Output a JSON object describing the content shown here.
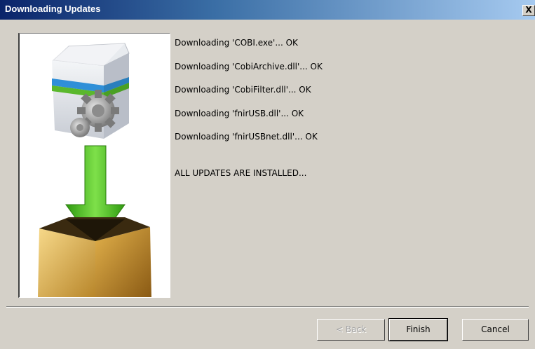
{
  "window": {
    "title": "Downloading Updates",
    "close_label": "X"
  },
  "log": {
    "lines": [
      "Downloading 'COBI.exe'... OK",
      "Downloading 'CobiArchive.dll'... OK",
      "Downloading 'CobiFilter.dll'... OK",
      "Downloading 'fnirUSB.dll'... OK",
      "Downloading 'fnirUSBnet.dll'... OK"
    ],
    "status": "ALL UPDATES ARE INSTALLED..."
  },
  "buttons": {
    "back": "< Back",
    "finish": "Finish",
    "cancel": "Cancel"
  },
  "colors": {
    "titlebar_start": "#0a246a",
    "titlebar_end": "#a6caf0",
    "dialog_bg": "#d4d0c8",
    "arrow_green": "#44bb22"
  }
}
